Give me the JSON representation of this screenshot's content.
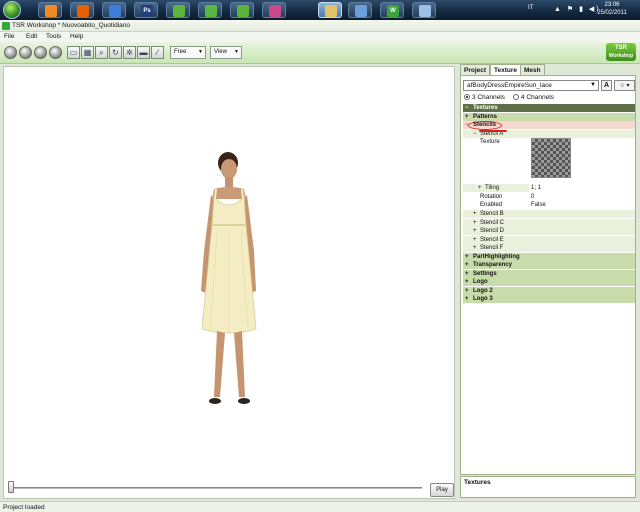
{
  "taskbar": {
    "apps": [
      {
        "name": "media-player",
        "color": "#f08a24"
      },
      {
        "name": "firefox",
        "color": "#e66000"
      },
      {
        "name": "ie",
        "color": "#3b7dd8"
      },
      {
        "name": "photoshop",
        "color": "#1f3e7a",
        "label": "Ps"
      },
      {
        "name": "sims-app-1",
        "color": "#5db53e"
      },
      {
        "name": "sims-app-2",
        "color": "#58b844"
      },
      {
        "name": "sims-app-3",
        "color": "#5bb43b"
      },
      {
        "name": "sims-app-4",
        "color": "#c84a8a"
      },
      {
        "name": "folder",
        "color": "#e3c36a"
      },
      {
        "name": "app-circle",
        "color": "#6aa0d9"
      },
      {
        "name": "tsr-workshop",
        "color": "#3aa53a",
        "label": "W"
      },
      {
        "name": "app-round",
        "color": "#9cc0e8"
      }
    ],
    "language": "IT",
    "tray_symbols": "▲ ⚑ ▮ ◀)",
    "time": "23:06",
    "date": "25/02/2011"
  },
  "window": {
    "title": "TSR Workshop * Nuovoabito_Quotidiano"
  },
  "menu": [
    "File",
    "Edit",
    "Tools",
    "Help"
  ],
  "toolbar": {
    "dropdown1": "Free",
    "dropdown2": "View",
    "logo_line1": "TSR",
    "logo_line2": "Workshop"
  },
  "viewport": {
    "play_label": "Play",
    "timeline_position": 0
  },
  "panel": {
    "tabs": [
      "Project",
      "Texture",
      "Mesh"
    ],
    "active_tab": "Texture",
    "material_select": "afBodyDressEmpireSun_lace",
    "btn_a": "A",
    "btn_fav": "☆ ▾",
    "channels": [
      "3 Channels",
      "4 Channels"
    ],
    "selected_channel": "3 Channels",
    "tree": {
      "textures": "Textures",
      "patterns": "Patterns",
      "stencils": "Stencils",
      "stencil_a": "Stencil A",
      "texture_label": "Texture",
      "tiling_label": "Tiling",
      "tiling_value": "1; 1",
      "rotation_label": "Rotation",
      "rotation_value": "0",
      "enabled_label": "Enabled",
      "enabled_value": "False",
      "stencil_b": "Stencil B",
      "stencil_c": "Stencil C",
      "stencil_d": "Stencil D",
      "stencil_e": "Stencil E",
      "stencil_f": "Stencil F",
      "parthighlighting": "PartHighlighting",
      "transparency": "Transparency",
      "settings": "Settings",
      "logo": "Logo",
      "logo2": "Logo 2",
      "logo3": "Logo 3"
    },
    "description_title": "Textures"
  },
  "status": "Project loaded",
  "colors": {
    "accent_green": "#c7dcaa",
    "section_dark": "#5f7049",
    "annotation_red": "#e02020"
  }
}
